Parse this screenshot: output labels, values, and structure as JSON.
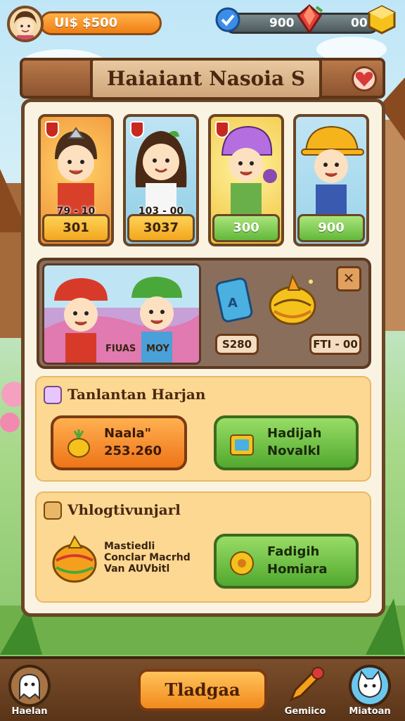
{
  "hud": {
    "coins": "UI$ $500",
    "gems": "900",
    "tokens": "00"
  },
  "title": "Haiaiant Nasoia S",
  "cards": [
    {
      "tag": "79 - 10",
      "price": "301",
      "style": "orange"
    },
    {
      "tag": "103 - 00",
      "price": "3037",
      "style": "orange"
    },
    {
      "tag": "",
      "price": "300",
      "style": "green"
    },
    {
      "tag": "",
      "price": "900",
      "style": "green"
    }
  ],
  "banner": {
    "label_left": "FIUAS",
    "label_right": "MOY",
    "price_left": "S280",
    "price_right": "FTI - 00",
    "close_label": "✕"
  },
  "daily": {
    "title": "Tanlantan Harjan",
    "buy_btn": {
      "line1": "Naala\"",
      "line2": "253.260"
    },
    "gift_btn": {
      "line1": "Hadijah",
      "line2": "Novalkl"
    }
  },
  "rewards": {
    "title": "Vhlogtivunjarl",
    "lines": [
      "Mastiedli",
      "Conclar Macrhd",
      "Van AUVbitl"
    ],
    "claim_btn": {
      "line1": "Fadigih",
      "line2": "Homiara"
    }
  },
  "bottom_nav": {
    "left_label": "Haelan",
    "center_label": "Tladgaa",
    "right1_label": "Gemiico",
    "right2_label": "Miatoan"
  }
}
